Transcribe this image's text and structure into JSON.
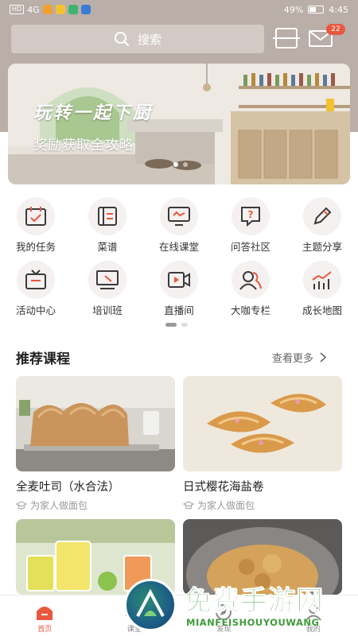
{
  "status_bar": {
    "network": "HD",
    "signal": "4G",
    "battery_percent": "49%",
    "time": "4:45"
  },
  "header": {
    "search_placeholder": "搜索",
    "mail_badge": "22",
    "search_icon": "search-icon",
    "scan_icon": "scan-icon",
    "mail_icon": "mail-icon"
  },
  "banner": {
    "title": "玩转一起下厨",
    "subtitle": "奖励获取全攻略",
    "slide_count": 2,
    "active_slide": 1
  },
  "menu": {
    "items": [
      {
        "label": "我的任务",
        "icon": "task-calendar-icon"
      },
      {
        "label": "菜谱",
        "icon": "recipe-book-icon"
      },
      {
        "label": "在线课堂",
        "icon": "online-class-icon"
      },
      {
        "label": "问答社区",
        "icon": "qa-icon"
      },
      {
        "label": "主题分享",
        "icon": "pencil-icon"
      },
      {
        "label": "活动中心",
        "icon": "tv-icon"
      },
      {
        "label": "培训班",
        "icon": "training-icon"
      },
      {
        "label": "直播间",
        "icon": "live-video-icon"
      },
      {
        "label": "大咖专栏",
        "icon": "expert-users-icon"
      },
      {
        "label": "成长地图",
        "icon": "growth-chart-icon"
      }
    ]
  },
  "section": {
    "title": "推荐课程",
    "see_more": "查看更多"
  },
  "courses": [
    {
      "name": "全麦吐司（水合法）",
      "sub": "为家人做面包"
    },
    {
      "name": "日式樱花海盐卷",
      "sub": "为家人做面包"
    }
  ],
  "tab_bar": {
    "tabs": [
      {
        "label": "首页",
        "icon": "home-icon",
        "active": true
      },
      {
        "label": "课堂",
        "icon": "classroom-icon",
        "active": false
      },
      {
        "label": "发现",
        "icon": "discover-icon",
        "active": false
      },
      {
        "label": "我的",
        "icon": "profile-icon",
        "active": false
      }
    ]
  },
  "watermark": {
    "title": "免费手游网",
    "url": "MIANFEISHOUYOUWANG"
  },
  "colors": {
    "header_bg": "#b9aea8",
    "accent": "#e8583e",
    "icon_stroke": "#3a3a3a"
  }
}
